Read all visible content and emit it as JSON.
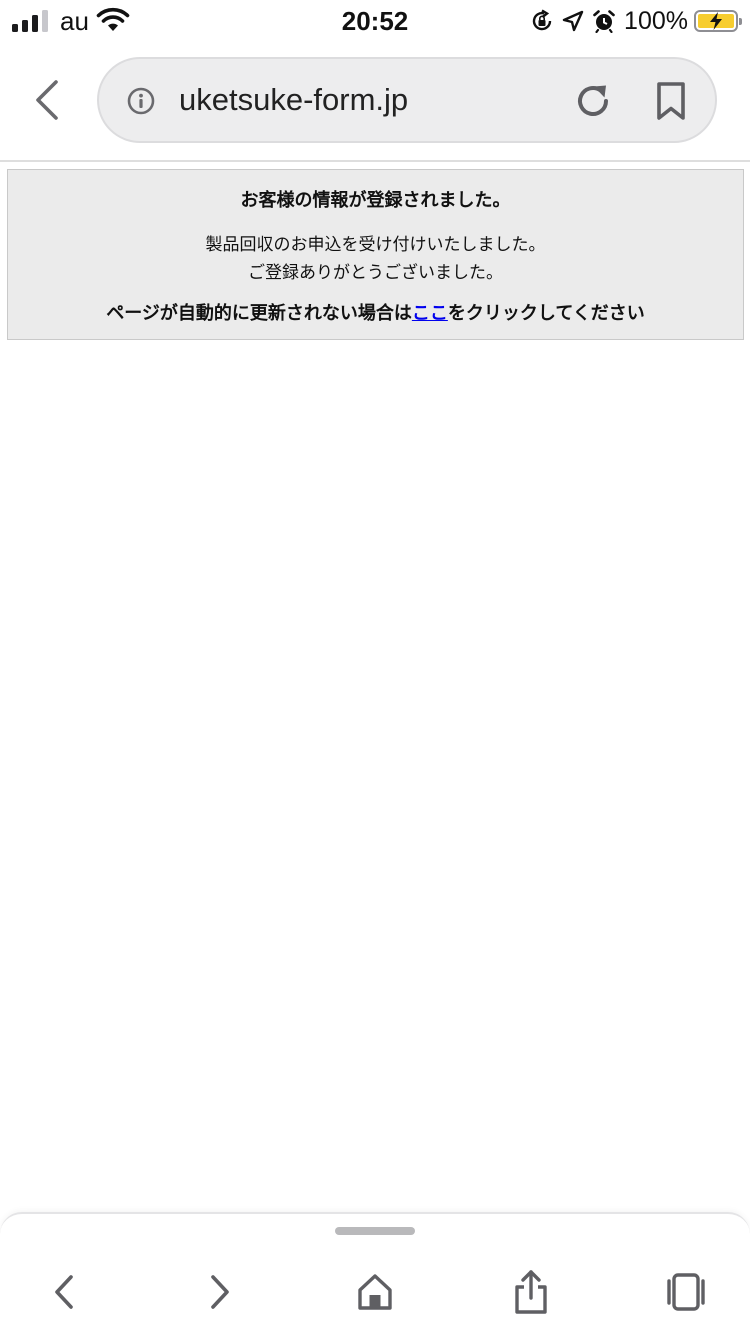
{
  "status_bar": {
    "carrier": "au",
    "time": "20:52",
    "battery_percent": "100%",
    "battery_level": 1.0,
    "icons": [
      "signal-icon",
      "wifi-icon",
      "orientation-lock-icon",
      "location-icon",
      "alarm-icon",
      "battery-charging-icon"
    ]
  },
  "browser": {
    "url": "uketsuke-form.jp",
    "icons": [
      "back-chevron-icon",
      "info-icon",
      "reload-icon",
      "bookmark-icon"
    ]
  },
  "page": {
    "title": "お客様の情報が登録されました。",
    "message_line1": "製品回収のお申込を受け付けいたしました。",
    "message_line2": "ご登録ありがとうございました。",
    "redirect_prefix": "ページが自動的に更新されない場合は",
    "redirect_link": "ここ",
    "redirect_suffix": "をクリックしてください",
    "link_color": "#0000ee",
    "box_background": "#ebebeb"
  },
  "toolbar": {
    "buttons": [
      "back-icon",
      "forward-icon",
      "home-icon",
      "share-icon",
      "tabs-icon"
    ]
  }
}
